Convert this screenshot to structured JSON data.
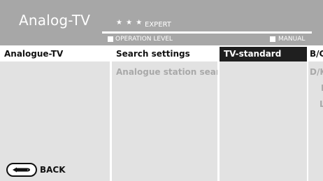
{
  "header": {
    "title": "Analog-TV",
    "stars": "★ ★ ★",
    "level_name": "EXPERT",
    "operation_level_label": "OPERATION LEVEL",
    "manual_label": "MANUAL"
  },
  "menu": {
    "col1": {
      "items": [
        {
          "label": "Analogue-TV"
        }
      ]
    },
    "col2": {
      "items": [
        {
          "label": "Search settings"
        },
        {
          "label": "Analogue station search"
        }
      ]
    },
    "col3": {
      "items": [
        {
          "label": "TV-standard"
        }
      ]
    },
    "col4": {
      "options": [
        {
          "label": "B/G"
        },
        {
          "label": "D/K"
        },
        {
          "label": "I"
        },
        {
          "label": "L"
        }
      ]
    }
  },
  "footer": {
    "back_label": "BACK",
    "back_icon": "back-arrow-icon"
  }
}
